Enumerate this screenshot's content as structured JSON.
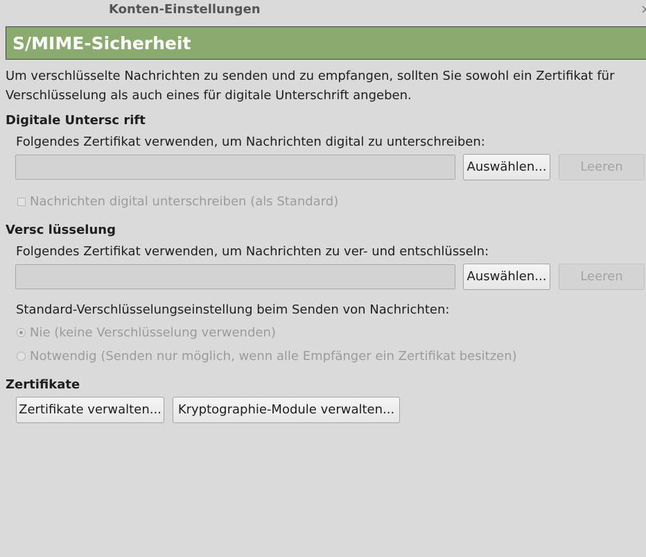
{
  "window": {
    "title": "Konten-Einstellungen",
    "close": "×"
  },
  "header": {
    "title": "S/MIME-Sicherheit"
  },
  "intro": "Um verschlüsselte Nachrichten zu senden und zu empfangen, sollten Sie sowohl ein Zertifikat für Verschlüsselung als auch eines für digitale Unterschrift angeben.",
  "signing": {
    "heading": "Digitale Untersc  rift",
    "label": "Folgendes Zertifikat verwenden, um Nachrichten digital zu unterschreiben:",
    "cert_value": "",
    "select_button": "Auswählen...",
    "clear_button": "Leeren",
    "checkbox_label": "Nachrichten digital unterschreiben (als Standard)",
    "checkbox_checked": false
  },
  "encryption": {
    "heading": "Versc  lüsselung",
    "label": "Folgendes Zertifikat verwenden, um Nachrichten zu ver- und entschlüsseln:",
    "cert_value": "",
    "select_button": "Auswählen...",
    "clear_button": "Leeren",
    "default_label": "Standard-Verschlüsselungseinstellung beim Senden von Nachrichten:",
    "options": [
      {
        "label": "Nie (keine Verschlüsselung verwenden)",
        "selected": true
      },
      {
        "label": "Notwendig (Senden nur möglich, wenn alle Empfänger ein Zertifikat besitzen)",
        "selected": false
      }
    ]
  },
  "certificates": {
    "heading": "Zertifikate",
    "manage_button": "Zertifikate verwalten...",
    "modules_button": "Kryptographie-Module verwalten..."
  },
  "colors": {
    "banner": "#8aab6e",
    "background": "#dadada",
    "disabled_text": "#9b9b9b"
  }
}
